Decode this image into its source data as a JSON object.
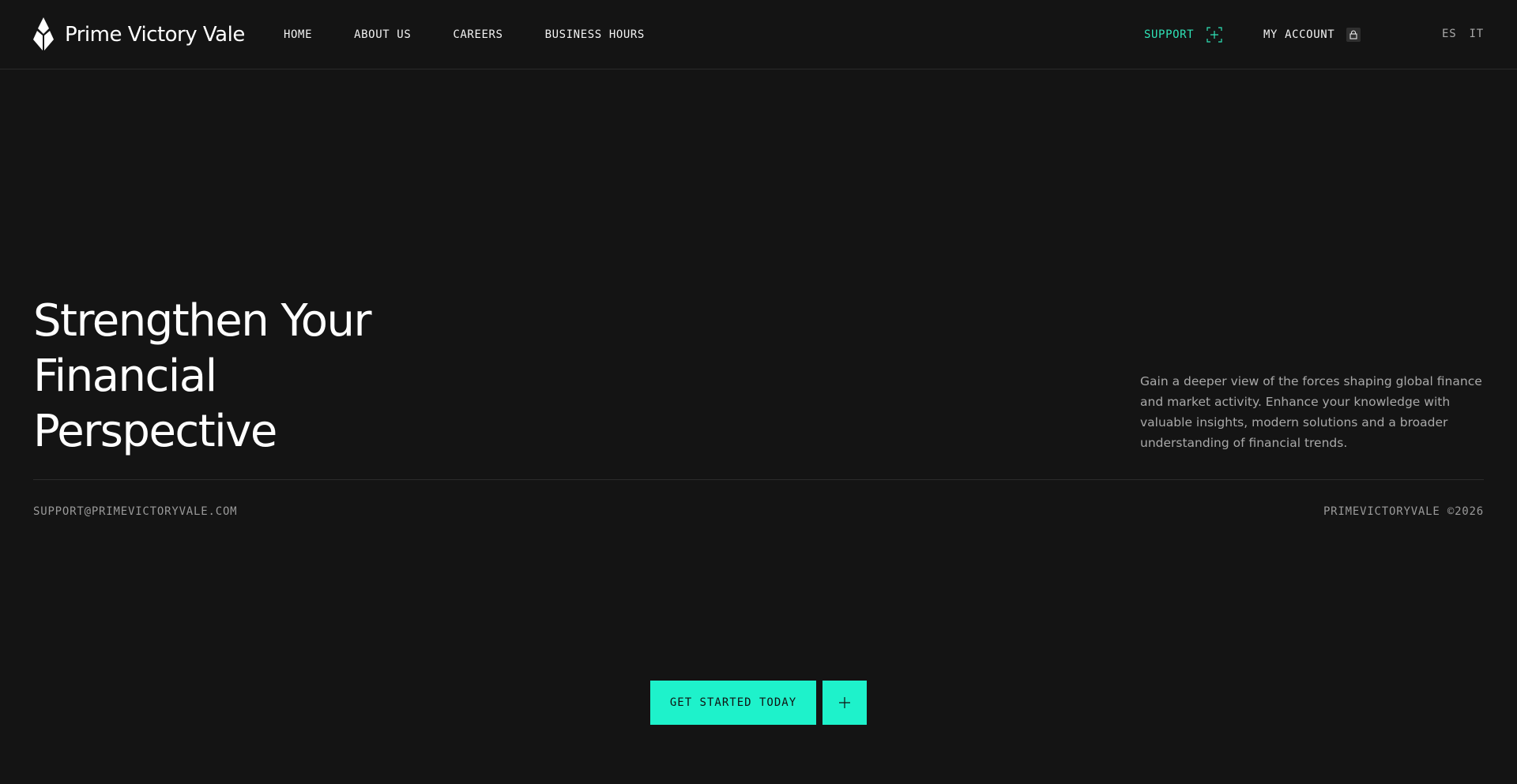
{
  "brand": {
    "name": "Prime Victory Vale",
    "logo_icon": "diamond-flame-logo-icon"
  },
  "nav": {
    "items": [
      {
        "label": "HOME"
      },
      {
        "label": "ABOUT US"
      },
      {
        "label": "CAREERS"
      },
      {
        "label": "BUSINESS HOURS"
      }
    ]
  },
  "header_actions": {
    "support_label": "SUPPORT",
    "support_icon": "plus-square-icon",
    "account_label": "MY ACCOUNT",
    "account_icon": "lock-icon",
    "languages": [
      "ES",
      "IT"
    ]
  },
  "hero": {
    "title_lines": [
      "Strengthen Your",
      "Financial",
      "Perspective"
    ],
    "description": "Gain a deeper view of the forces shaping global finance and market activity. Enhance your knowledge with valuable insights, modern solutions and a broader understanding of financial trends."
  },
  "footer": {
    "email": "SUPPORT@PRIMEVICTORYVALE.COM",
    "copyright": "PRIMEVICTORYVALE ©2026"
  },
  "cta": {
    "label": "GET STARTED TODAY",
    "plus_icon": "plus-icon"
  },
  "colors": {
    "background": "#141414",
    "accent": "#1ef2cb",
    "support_text": "#2fe2b6",
    "muted_text": "#a9a9a9"
  }
}
